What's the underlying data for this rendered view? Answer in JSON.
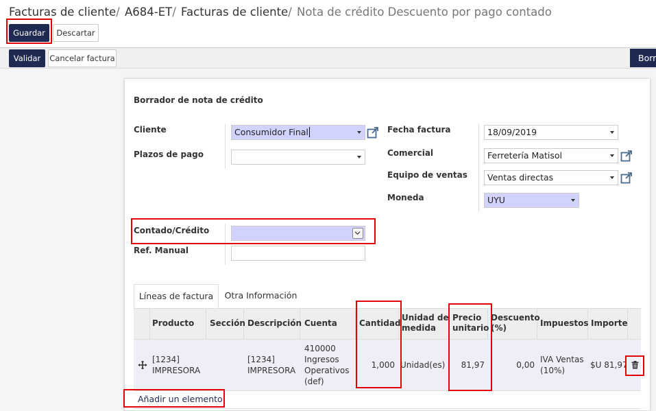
{
  "breadcrumb": {
    "items": [
      "Facturas de cliente",
      "A684-ET",
      "Facturas de cliente"
    ],
    "separator": "/",
    "current": "Nota de crédito Descuento por pago contado"
  },
  "actions": {
    "save": "Guardar",
    "discard": "Descartar"
  },
  "statusbar": {
    "validate": "Validar",
    "cancel_invoice": "Cancelar factura",
    "state": "Borrador"
  },
  "form": {
    "title": "Borrador de nota de crédito",
    "left": {
      "customer_label": "Cliente",
      "customer_value": "Consumidor Final",
      "payment_terms_label": "Plazos de pago",
      "payment_terms_value": "",
      "cash_credit_label": "Contado/Crédito",
      "cash_credit_value": "",
      "manual_ref_label": "Ref. Manual",
      "manual_ref_value": ""
    },
    "right": {
      "invoice_date_label": "Fecha factura",
      "invoice_date_value": "18/09/2019",
      "salesperson_label": "Comercial",
      "salesperson_value": "Ferretería Matisol",
      "sales_team_label": "Equipo de ventas",
      "sales_team_value": "Ventas directas",
      "currency_label": "Moneda",
      "currency_value": "UYU"
    }
  },
  "tabs": [
    "Líneas de factura",
    "Otra Información"
  ],
  "table": {
    "headers": {
      "product": "Producto",
      "section": "Sección",
      "description": "Descripción",
      "account": "Cuenta",
      "quantity": "Cantidad",
      "uom_1": "Unidad de",
      "uom_2": "medida",
      "price_1": "Precio",
      "price_2": "unitario",
      "discount_1": "Descuento",
      "discount_2": "(%)",
      "taxes": "Impuestos",
      "amount": "Importe"
    },
    "rows": [
      {
        "product_1": "[1234]",
        "product_2": "IMPRESORA",
        "description_1": "[1234]",
        "description_2": "IMPRESORA",
        "account_1": "410000",
        "account_2": "Ingresos",
        "account_3": "Operativos",
        "account_4": "(def)",
        "quantity": "1,000",
        "uom": "Unidad(es)",
        "price": "81,97",
        "discount": "0,00",
        "taxes_1": "IVA Ventas",
        "taxes_2": "(10%)",
        "amount": "$U 81,97"
      }
    ],
    "add_line": "Añadir un elemento"
  },
  "colors": {
    "primary": "#1e2a52",
    "required_field": "#d2d2ff",
    "highlight": "#e00000"
  }
}
